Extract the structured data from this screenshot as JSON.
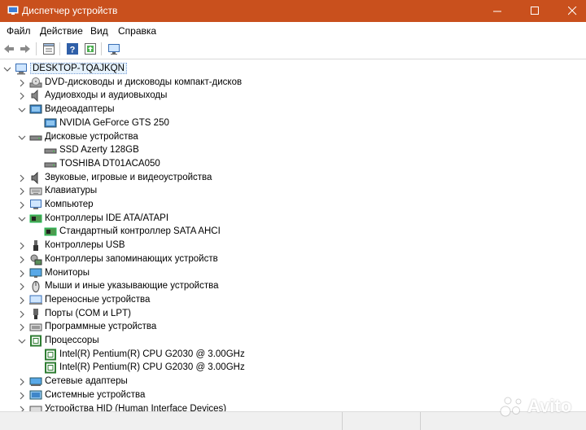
{
  "window": {
    "title": "Диспетчер устройств",
    "controls": {
      "minimize": "minimize",
      "maximize": "maximize",
      "close": "close"
    }
  },
  "menu": [
    "Файл",
    "Действие",
    "Вид",
    "Справка"
  ],
  "toolbar": [
    "back-arrow-icon",
    "forward-arrow-icon",
    "properties-icon",
    "help-icon",
    "monitor-scan-icon"
  ],
  "tree": {
    "root": "DESKTOP-TQAJKQN",
    "items": [
      {
        "label": "DVD-дисководы и дисководы компакт-дисков",
        "icon": "dvd-drive-icon",
        "expanded": false,
        "children": []
      },
      {
        "label": "Аудиовходы и аудиовыходы",
        "icon": "speaker-icon",
        "expanded": false,
        "children": []
      },
      {
        "label": "Видеоадаптеры",
        "icon": "display-adapter-icon",
        "expanded": true,
        "children": [
          "NVIDIA GeForce GTS 250"
        ]
      },
      {
        "label": "Дисковые устройства",
        "icon": "disk-drive-icon",
        "expanded": true,
        "children": [
          "SSD Azerty 128GB",
          "TOSHIBA DT01ACA050"
        ]
      },
      {
        "label": "Звуковые, игровые и видеоустройства",
        "icon": "sound-icon",
        "expanded": false,
        "children": []
      },
      {
        "label": "Клавиатуры",
        "icon": "keyboard-icon",
        "expanded": false,
        "children": []
      },
      {
        "label": "Компьютер",
        "icon": "computer-icon",
        "expanded": false,
        "children": []
      },
      {
        "label": "Контроллеры IDE ATA/ATAPI",
        "icon": "ide-controller-icon",
        "expanded": true,
        "children": [
          "Стандартный контроллер SATA AHCI"
        ]
      },
      {
        "label": "Контроллеры USB",
        "icon": "usb-icon",
        "expanded": false,
        "children": []
      },
      {
        "label": "Контроллеры запоминающих устройств",
        "icon": "storage-controller-icon",
        "expanded": false,
        "children": []
      },
      {
        "label": "Мониторы",
        "icon": "monitor-icon",
        "expanded": false,
        "children": []
      },
      {
        "label": "Мыши и иные указывающие устройства",
        "icon": "mouse-icon",
        "expanded": false,
        "children": []
      },
      {
        "label": "Переносные устройства",
        "icon": "portable-device-icon",
        "expanded": false,
        "children": []
      },
      {
        "label": "Порты (COM и LPT)",
        "icon": "port-icon",
        "expanded": false,
        "children": []
      },
      {
        "label": "Программные устройства",
        "icon": "software-device-icon",
        "expanded": false,
        "children": []
      },
      {
        "label": "Процессоры",
        "icon": "processor-icon",
        "expanded": true,
        "children": [
          "Intel(R) Pentium(R) CPU G2030 @ 3.00GHz",
          "Intel(R) Pentium(R) CPU G2030 @ 3.00GHz"
        ]
      },
      {
        "label": "Сетевые адаптеры",
        "icon": "network-adapter-icon",
        "expanded": false,
        "children": []
      },
      {
        "label": "Системные устройства",
        "icon": "system-device-icon",
        "expanded": false,
        "children": []
      },
      {
        "label": "Устройства HID (Human Interface Devices)",
        "icon": "hid-icon",
        "expanded": false,
        "children": []
      }
    ]
  },
  "watermark": "Avito",
  "colors": {
    "titlebar": "#c9501d",
    "selection": "#e5f1fb",
    "chevron": "#606060"
  }
}
